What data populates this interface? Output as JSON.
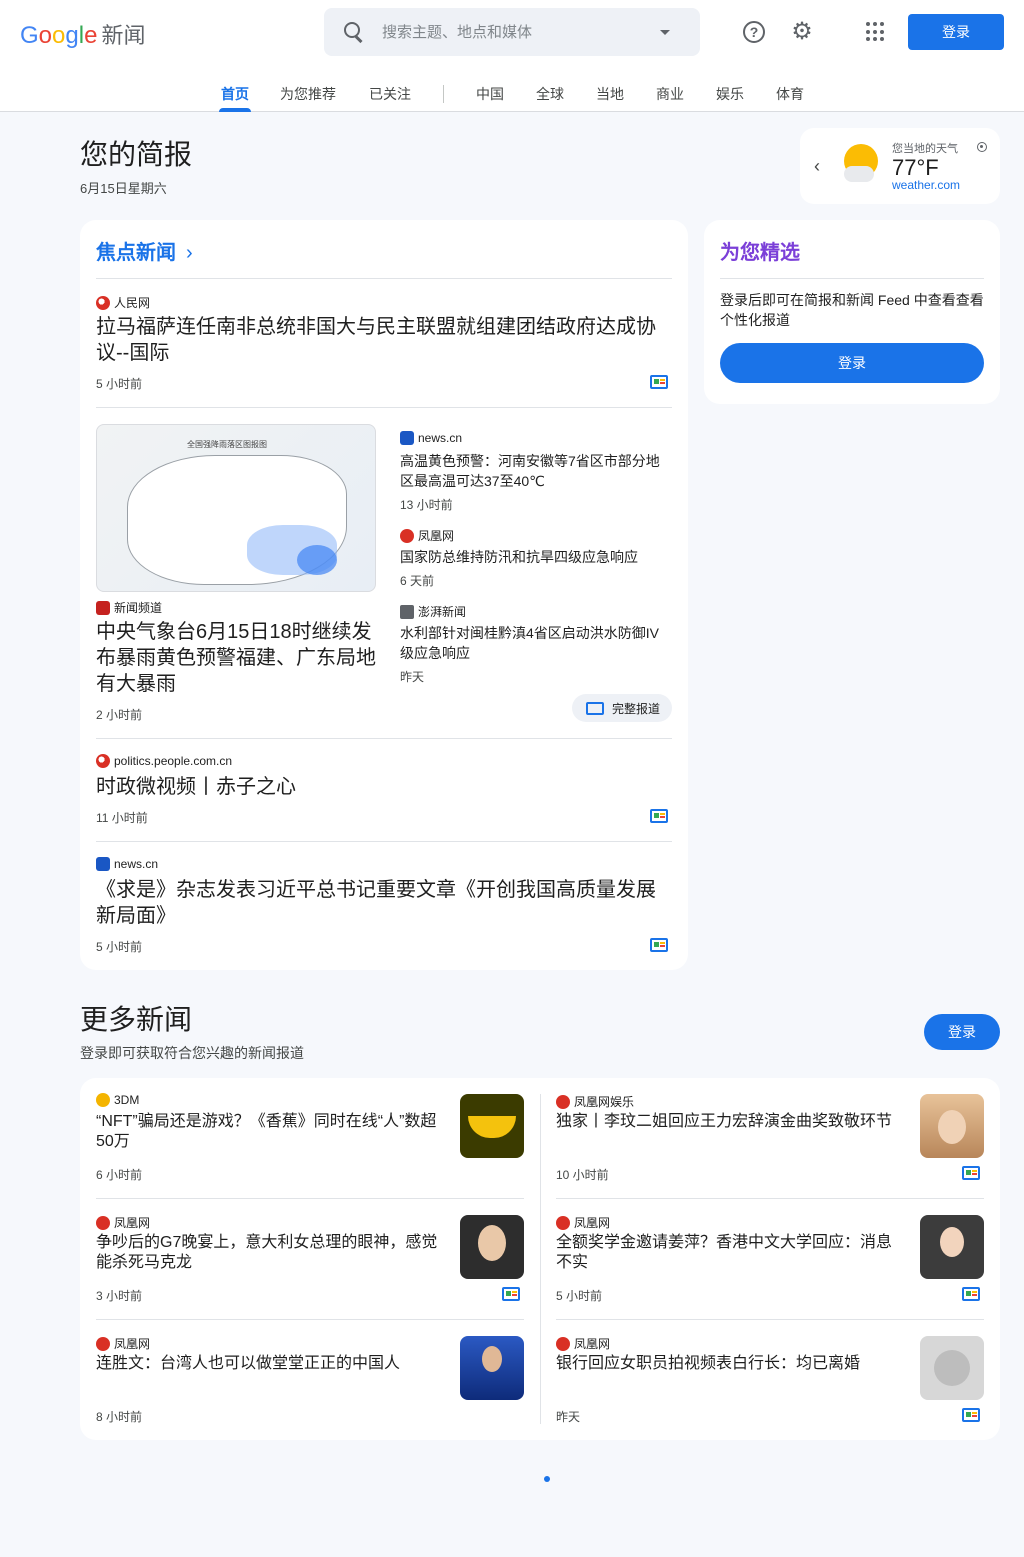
{
  "header": {
    "logo_google": [
      "G",
      "o",
      "o",
      "g",
      "l",
      "e"
    ],
    "logo_news": "新闻",
    "search_placeholder": "搜索主题、地点和媒体",
    "signin": "登录"
  },
  "nav": {
    "tabs": [
      "首页",
      "为您推荐",
      "已关注",
      "中国",
      "全球",
      "当地",
      "商业",
      "娱乐",
      "体育"
    ],
    "active": "首页"
  },
  "briefing": {
    "title": "您的简报",
    "date": "6月15日星期六"
  },
  "weather": {
    "label": "您当地的天气",
    "temp": "77°F",
    "source": "weather.com"
  },
  "top_stories": {
    "title": "焦点新闻",
    "item1": {
      "source": "人民网",
      "headline": "拉马福萨连任南非总统非国大与民主联盟就组建团结政府达成协议--国际",
      "time": "5 小时前"
    },
    "cluster": {
      "map_caption": "全国强降雨落区图报图",
      "main": {
        "source": "新闻频道",
        "headline": "中央气象台6月15日18时继续发布暴雨黄色预警福建、广东局地有大暴雨",
        "time": "2 小时前"
      },
      "side": [
        {
          "source": "news.cn",
          "headline": "高温黄色预警：河南安徽等7省区市部分地区最高温可达37至40℃",
          "time": "13 小时前"
        },
        {
          "source": "凤凰网",
          "headline": "国家防总维持防汛和抗旱四级应急响应",
          "time": "6 天前"
        },
        {
          "source": "澎湃新闻",
          "headline": "水利部针对闽桂黔滇4省区启动洪水防御IV级应急响应",
          "time": "昨天"
        }
      ],
      "full_coverage": "完整报道"
    },
    "item3": {
      "source": "politics.people.com.cn",
      "headline": "时政微视频丨赤子之心",
      "time": "11 小时前"
    },
    "item4": {
      "source": "news.cn",
      "headline": "《求是》杂志发表习近平总书记重要文章《开创我国高质量发展新局面》",
      "time": "5 小时前"
    }
  },
  "picks": {
    "title": "为您精选",
    "text": "登录后即可在简报和新闻 Feed 中查看查看个性化报道",
    "button": "登录"
  },
  "more": {
    "title": "更多新闻",
    "subtitle": "登录即可获取符合您兴趣的新闻报道",
    "button": "登录",
    "items": [
      {
        "source": "3DM",
        "headline": "“NFT”骗局还是游戏？《香蕉》同时在线“人”数超50万",
        "time": "6 小时前"
      },
      {
        "source": "凤凰网娱乐",
        "headline": "独家丨李玟二姐回应王力宏辞演金曲奖致敬环节",
        "time": "10 小时前"
      },
      {
        "source": "凤凰网",
        "headline": "争吵后的G7晚宴上，意大利女总理的眼神，感觉能杀死马克龙",
        "time": "3 小时前"
      },
      {
        "source": "凤凰网",
        "headline": "全额奖学金邀请姜萍？香港中文大学回应：消息不实",
        "time": "5 小时前"
      },
      {
        "source": "凤凰网",
        "headline": "连胜文：台湾人也可以做堂堂正正的中国人",
        "time": "8 小时前"
      },
      {
        "source": "凤凰网",
        "headline": "银行回应女职员拍视频表白行长：均已离婚",
        "time": "昨天"
      }
    ]
  },
  "icons": [
    "search-icon",
    "dropdown-caret-icon",
    "help-icon",
    "settings-gear-icon",
    "apps-grid-icon",
    "chevron-left-icon",
    "weather-partly-sunny-icon",
    "location-icon",
    "chevron-right-icon",
    "full-coverage-icon"
  ],
  "colors": {
    "accent": "#1a73e8",
    "picks_title": "#7b3fd8",
    "background": "#f6f8fc"
  }
}
